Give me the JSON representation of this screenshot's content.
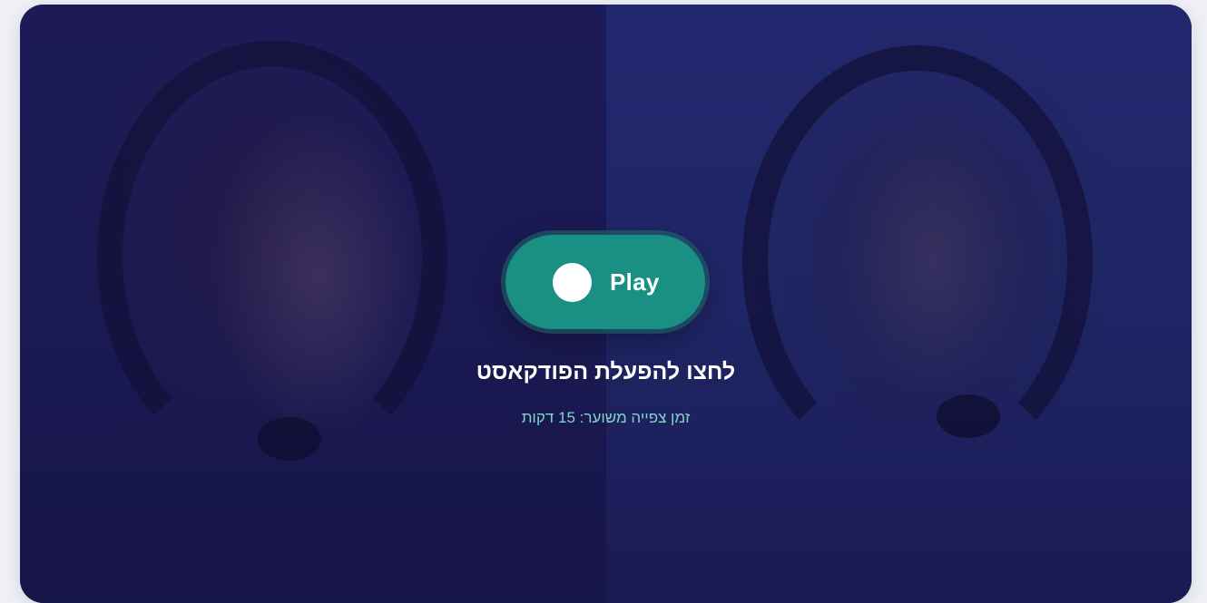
{
  "player": {
    "play_label": "Play",
    "title": "לחצו להפעלת הפודקאסט",
    "duration_text": "זמן צפייה משוער: 15 דקות"
  },
  "colors": {
    "background_tint": "#1a1858",
    "play_button": "#1a8f83",
    "subtitle_text": "#7fd6c8"
  },
  "icons": {
    "play": "circle"
  }
}
